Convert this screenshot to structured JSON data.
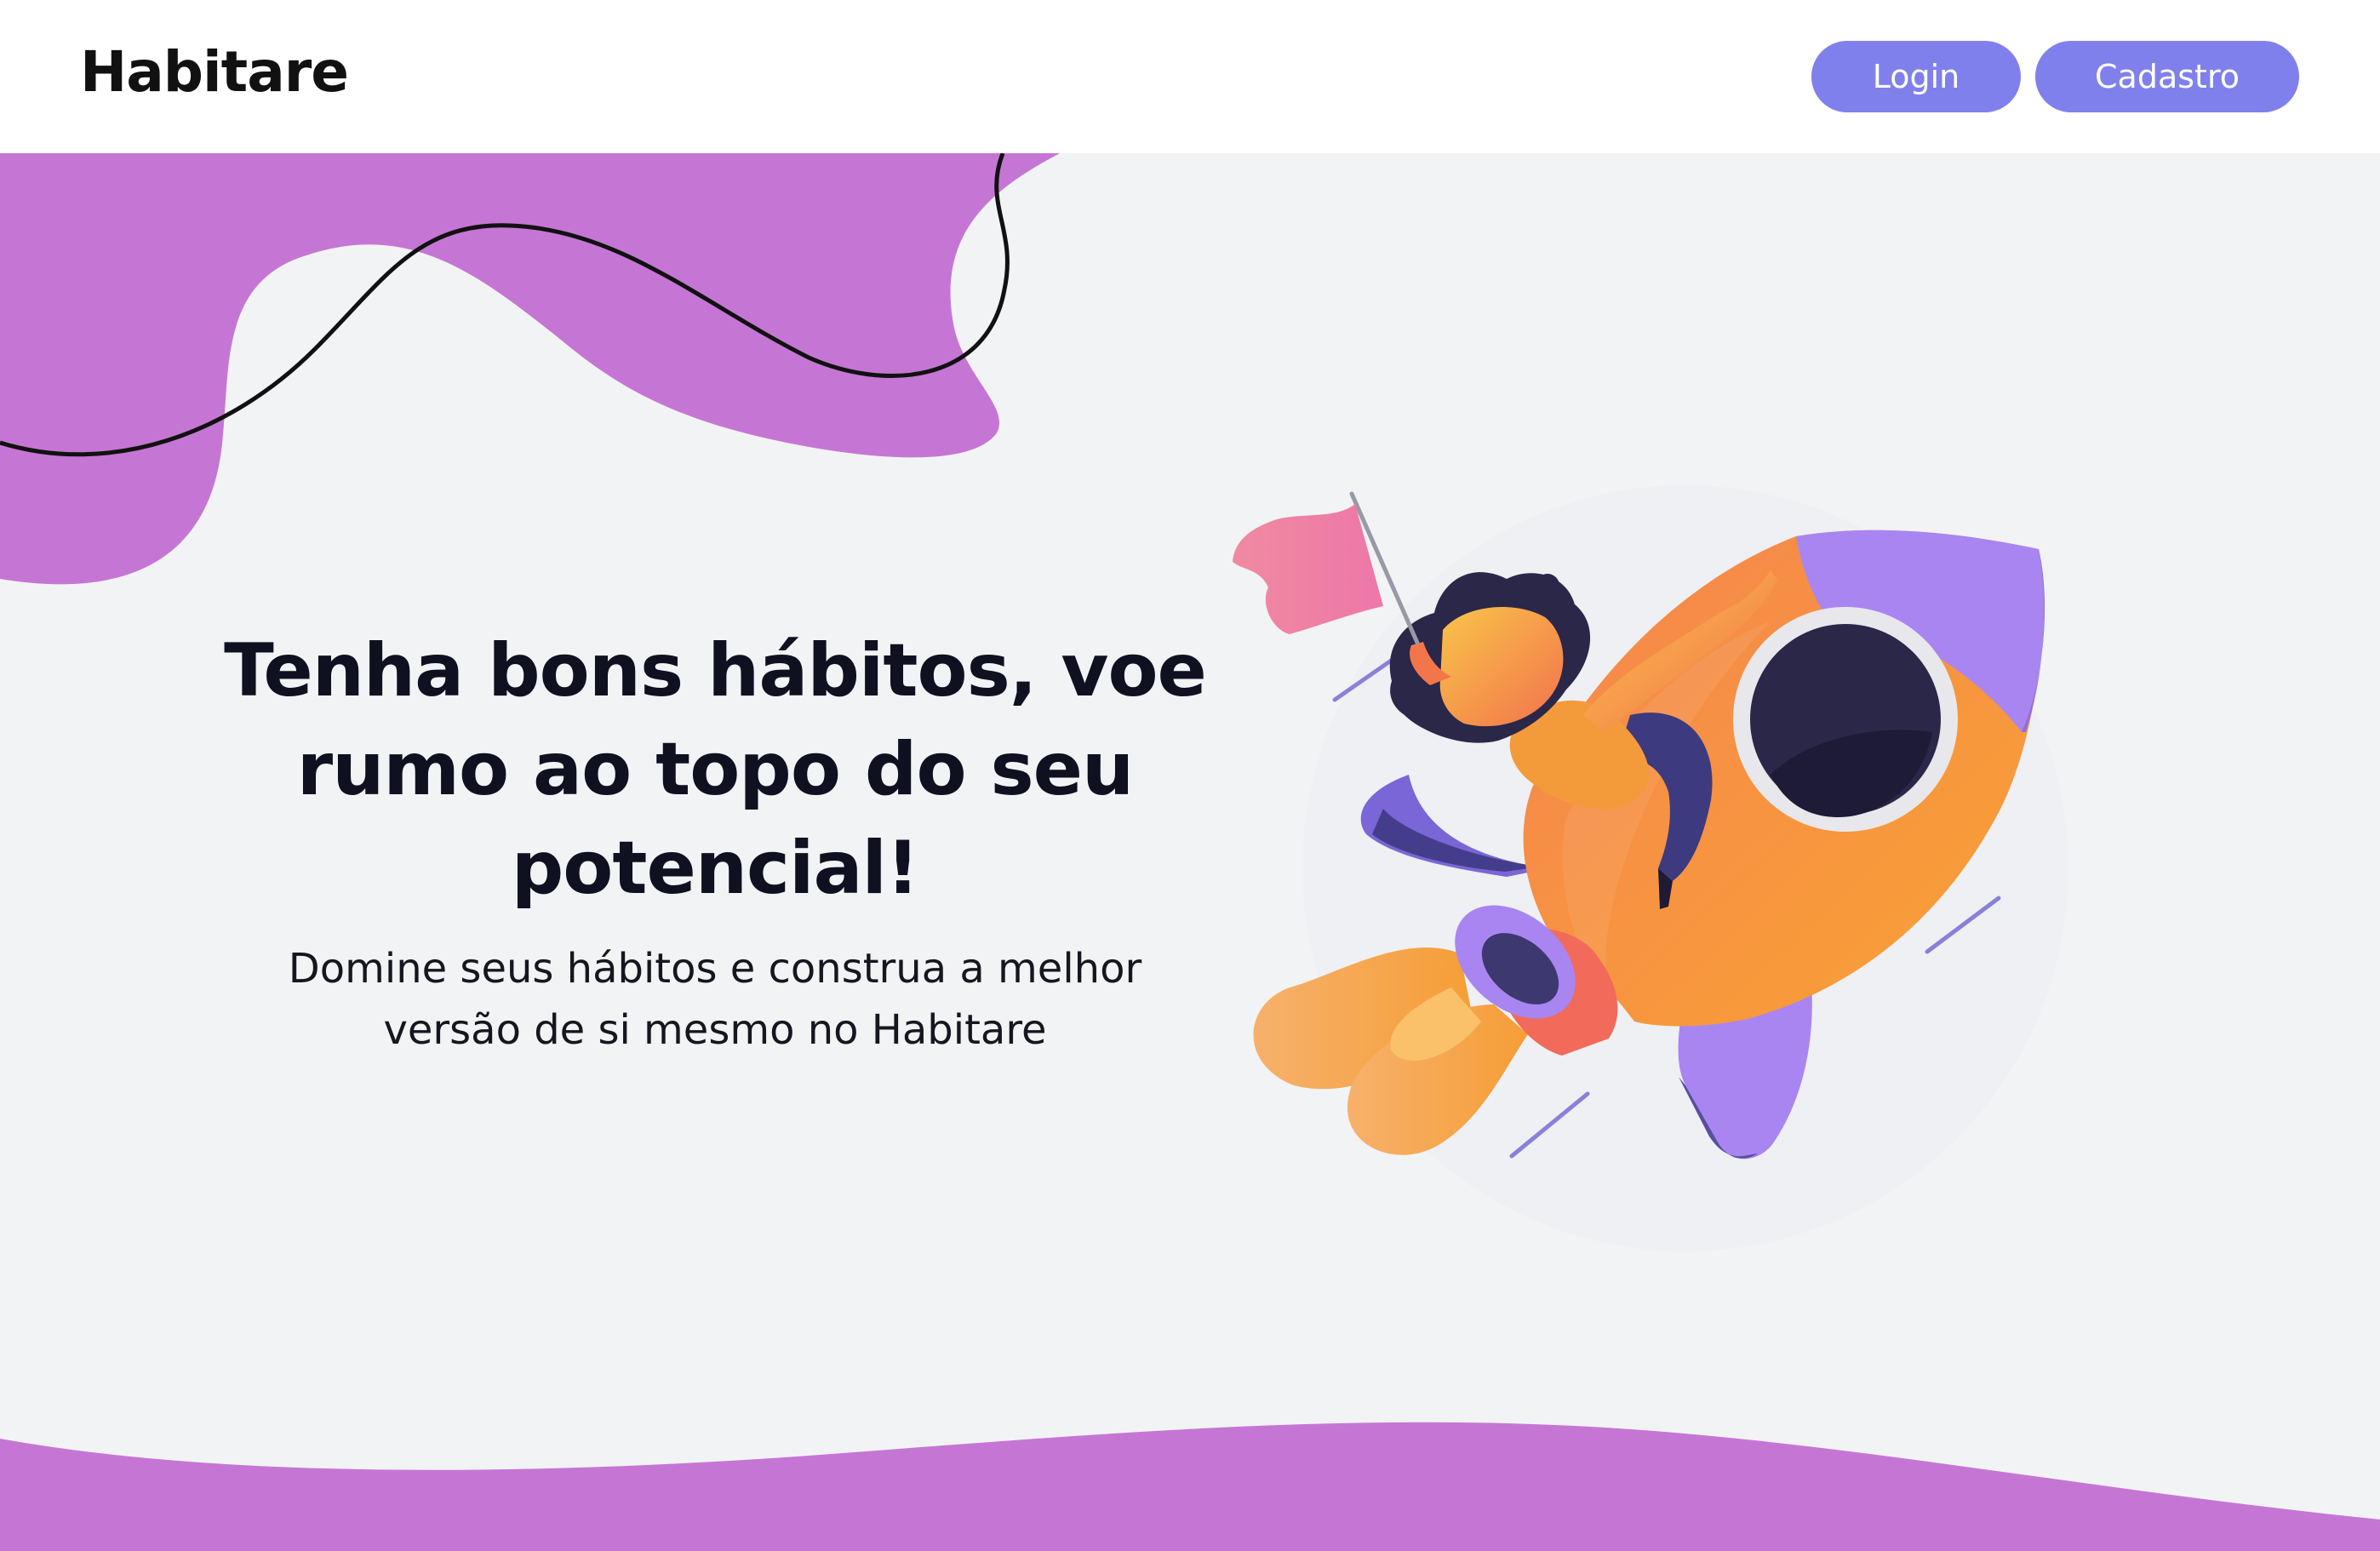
{
  "header": {
    "logo": "Habitare",
    "login_label": "Login",
    "signup_label": "Cadastro"
  },
  "hero": {
    "title": "Tenha bons hábitos, voe rumo ao topo do seu potencial!",
    "subtitle": "Domine seus hábitos e construa a melhor versão de si mesmo no Habitare"
  },
  "illustration": {
    "icon": "rocket-woman-flag-illustration"
  },
  "colors": {
    "accent_button": "#8080ec",
    "blob_purple": "#c576d4",
    "background": "#f2f3f5",
    "rocket_orange": "#f6923e",
    "rocket_purple": "#a985f2"
  }
}
